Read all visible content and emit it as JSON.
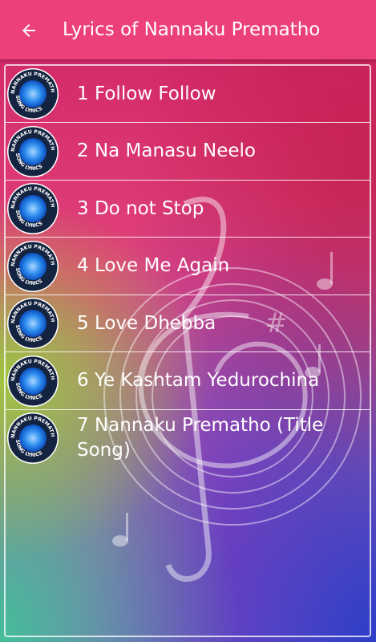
{
  "appbar": {
    "title": "Lyrics of Nannaku Prematho",
    "back_icon": "arrow-back-icon",
    "background": "#ec407a"
  },
  "badge": {
    "ring_text_top": "NANNAKU PREMATHO",
    "ring_text_bottom": "SONG LYRICS",
    "icon": "disc-logo-icon"
  },
  "songs": [
    {
      "label": "1 Follow Follow"
    },
    {
      "label": "2 Na Manasu Neelo"
    },
    {
      "label": "3 Do not Stop"
    },
    {
      "label": "4 Love Me Again"
    },
    {
      "label": "5 Love Dhebba"
    },
    {
      "label": "6 Ye Kashtam Yedurochina"
    },
    {
      "label": "7 Nannaku Prematho (Title Song)"
    }
  ]
}
